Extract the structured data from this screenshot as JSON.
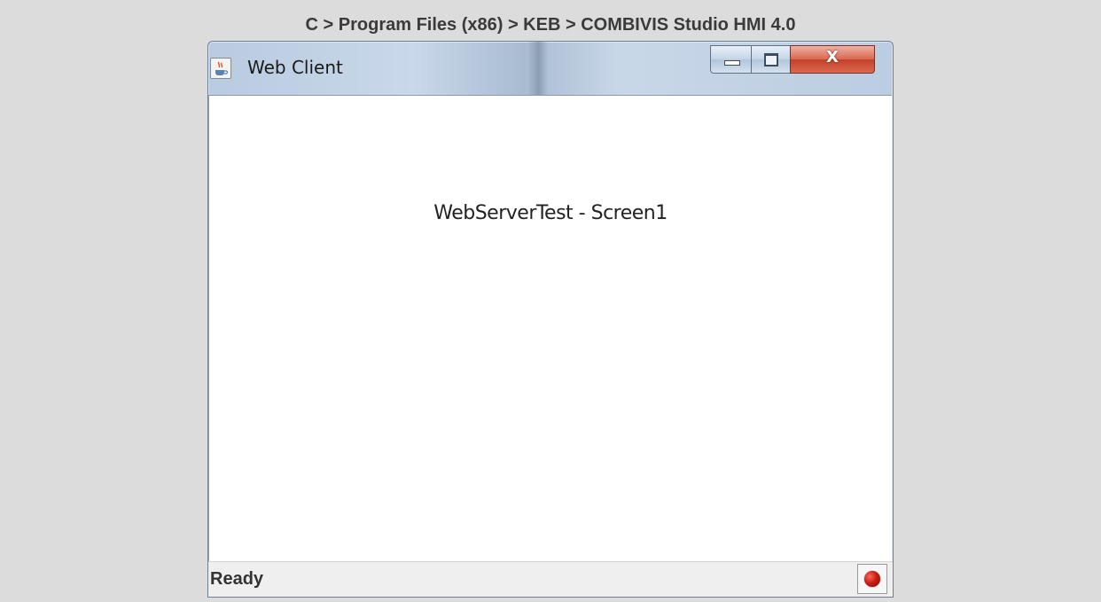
{
  "caption": {
    "breadcrumb": "C > Program Files (x86) > KEB > COMBIVIS Studio HMI 4.0"
  },
  "window": {
    "title": "Web Client",
    "icon": "java-app-icon",
    "controls": {
      "minimize_icon": "minimize-icon",
      "maximize_icon": "maximize-icon",
      "close_icon": "close-icon",
      "close_glyph": "X"
    }
  },
  "content": {
    "screen_title": "WebServerTest - Screen1"
  },
  "statusbar": {
    "status_text": "Ready",
    "indicator_icon": "red-status-led-icon",
    "indicator_color": "#c81e12"
  },
  "colors": {
    "background": "#dcdcdc",
    "titlebar": "#c9d8ea",
    "close_button": "#d9684f"
  }
}
